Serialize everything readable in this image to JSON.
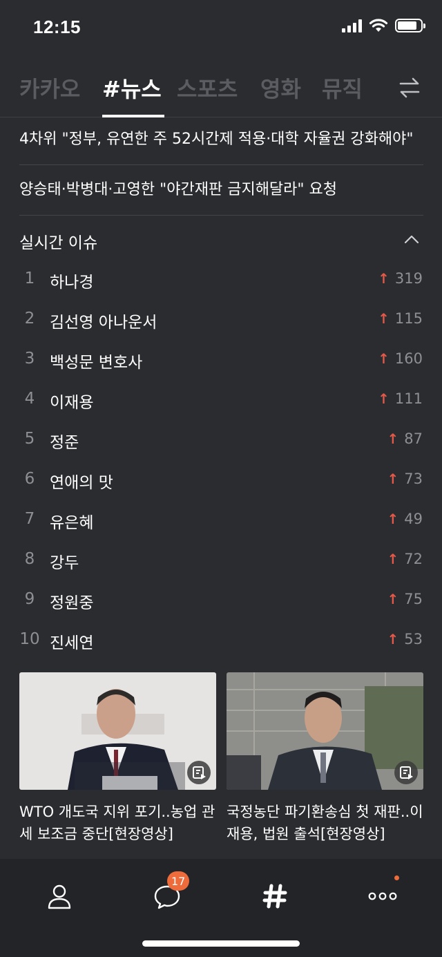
{
  "status": {
    "time": "12:15",
    "battery_level": 0.85
  },
  "tabs": [
    {
      "label": "카카오",
      "active": false
    },
    {
      "label": "#뉴스",
      "active": true
    },
    {
      "label": "스포츠",
      "active": false
    },
    {
      "label": "영화",
      "active": false
    },
    {
      "label": "뮤직",
      "active": false
    }
  ],
  "headlines": [
    "4차위 \"정부, 유연한 주 52시간제 적용·대학 자율권 강화해야\"",
    "양승태·박병대·고영한 \"야간재판 금지해달라\" 요청"
  ],
  "realtime": {
    "title": "실시간 이슈",
    "items": [
      {
        "rank": "1",
        "name": "하나경",
        "change": "319"
      },
      {
        "rank": "2",
        "name": "김선영 아나운서",
        "change": "115"
      },
      {
        "rank": "3",
        "name": "백성문 변호사",
        "change": "160"
      },
      {
        "rank": "4",
        "name": "이재용",
        "change": "111"
      },
      {
        "rank": "5",
        "name": "정준",
        "change": "87"
      },
      {
        "rank": "6",
        "name": "연애의 맛",
        "change": "73"
      },
      {
        "rank": "7",
        "name": "유은혜",
        "change": "49"
      },
      {
        "rank": "8",
        "name": "강두",
        "change": "72"
      },
      {
        "rank": "9",
        "name": "정원중",
        "change": "75"
      },
      {
        "rank": "10",
        "name": "진세연",
        "change": "53"
      }
    ],
    "arrow_color": "#e45a4a"
  },
  "cards": [
    {
      "title": "WTO 개도국 지위 포기..농업 관세 보조금 중단[현장영상]",
      "thumb_icon": "speaker-at-podium-photo"
    },
    {
      "title": "국정농단 파기환송심 첫 재판..이재용, 법원 출석[현장영상]",
      "thumb_icon": "man-in-suit-photo"
    }
  ],
  "bottom_nav": {
    "chat_badge": "17",
    "icons": [
      "person-icon",
      "chat-icon",
      "hash-icon",
      "more-icon"
    ]
  },
  "colors": {
    "background": "#2b2c30",
    "accent": "#ee6b3b"
  }
}
